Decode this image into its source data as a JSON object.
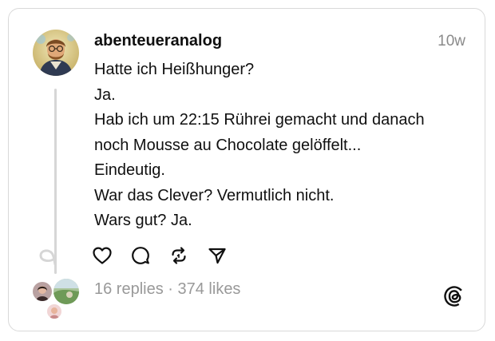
{
  "post": {
    "username": "abenteueranalog",
    "timestamp": "10w",
    "lines": [
      "Hatte ich Heißhunger?",
      "Ja.",
      "Hab ich um 22:15 Rührei gemacht und danach",
      "noch Mousse au Chocolate gelöffelt...",
      "Eindeutig.",
      "War das Clever? Vermutlich nicht.",
      "Wars gut? Ja."
    ]
  },
  "actions": {
    "icons": [
      "heart-icon",
      "comment-icon",
      "repost-icon",
      "share-icon"
    ]
  },
  "footer": {
    "replies": "16 replies",
    "separator": " · ",
    "likes": "374 likes",
    "logo_icon": "threads-logo-icon"
  },
  "colors": {
    "text": "#101010",
    "muted": "#999999",
    "border": "#d9d9d9",
    "thread_line": "#d6d6d6"
  }
}
